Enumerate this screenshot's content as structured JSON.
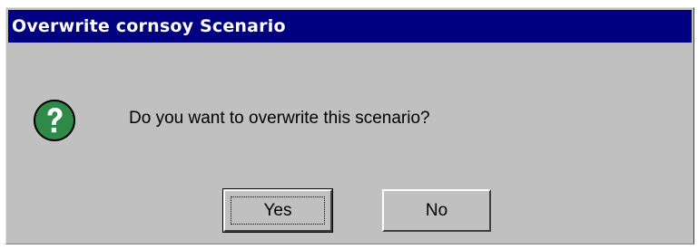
{
  "dialog": {
    "title": "Overwrite cornsoy Scenario",
    "message": "Do you want to overwrite this scenario?",
    "icon": "question-icon",
    "buttons": {
      "yes_label": "Yes",
      "no_label": "No"
    }
  },
  "colors": {
    "titlebar": "#000080",
    "dialog_bg": "#c0c0c0",
    "icon_fill": "#2f8a4a"
  }
}
